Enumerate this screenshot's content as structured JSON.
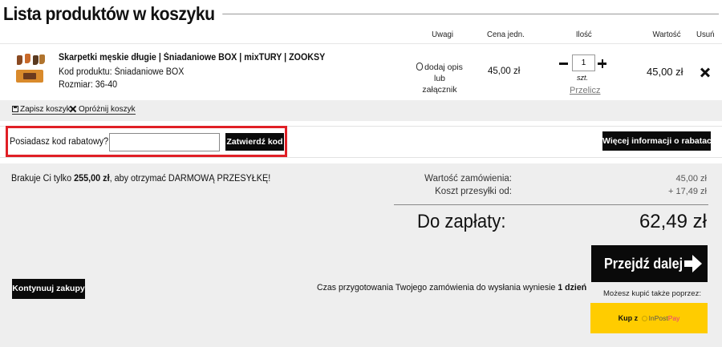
{
  "page": {
    "title": "Lista produktów w koszyku"
  },
  "table_headers": {
    "notes": "Uwagi",
    "unit_price": "Cena jedn.",
    "quantity": "Ilość",
    "value": "Wartość",
    "remove": "Usuń"
  },
  "cart_item": {
    "name": "Skarpetki męskie długie | Śniadaniowe BOX | mixTURY | ZOOKSY",
    "code": "Kod produktu: Śniadaniowe BOX",
    "size": "Rozmiar: 36-40",
    "note_link": "dodaj opis lub załącznik",
    "unit_price": "45,00 zł",
    "quantity": "1",
    "quantity_unit": "szt.",
    "recalc": "Przelicz",
    "value": "45,00 zł"
  },
  "cart_actions": {
    "save_cart": "Zapisz koszyk",
    "empty_cart": "Opróżnij koszyk"
  },
  "discount": {
    "label": "Posiadasz kod rabatowy?",
    "input_value": "",
    "confirm_button": "Zatwierdź kod",
    "more_info_button": "Więcej informacji o rabatach",
    "highlight_color": "#e01f26"
  },
  "summary": {
    "free_shipping_before": "Brakuje Ci tylko ",
    "free_shipping_amount": "255,00 zł",
    "free_shipping_after": ", aby otrzymać DARMOWĄ PRZESYŁKĘ!",
    "order_value_label": "Wartość zamówienia:",
    "order_value": "45,00 zł",
    "shipping_label": "Koszt przesyłki od:",
    "shipping_value": "+ 17,49 zł",
    "total_label": "Do zapłaty:",
    "total_value": "62,49 zł"
  },
  "checkout": {
    "proceed_button": "Przejdź dalej",
    "continue_button": "Kontynuuj zakupy",
    "prep_time_text": "Czas przygotowania Twojego zamówienia do wysłania wyniesie ",
    "prep_time_value": "1 dzień",
    "also_buy_text": "Możesz kupić także poprzez:",
    "inpost_prefix": "Kup z",
    "inpost_brand": "InPost",
    "inpost_pay": "Pay",
    "inpost_color": "#ffcc00"
  }
}
